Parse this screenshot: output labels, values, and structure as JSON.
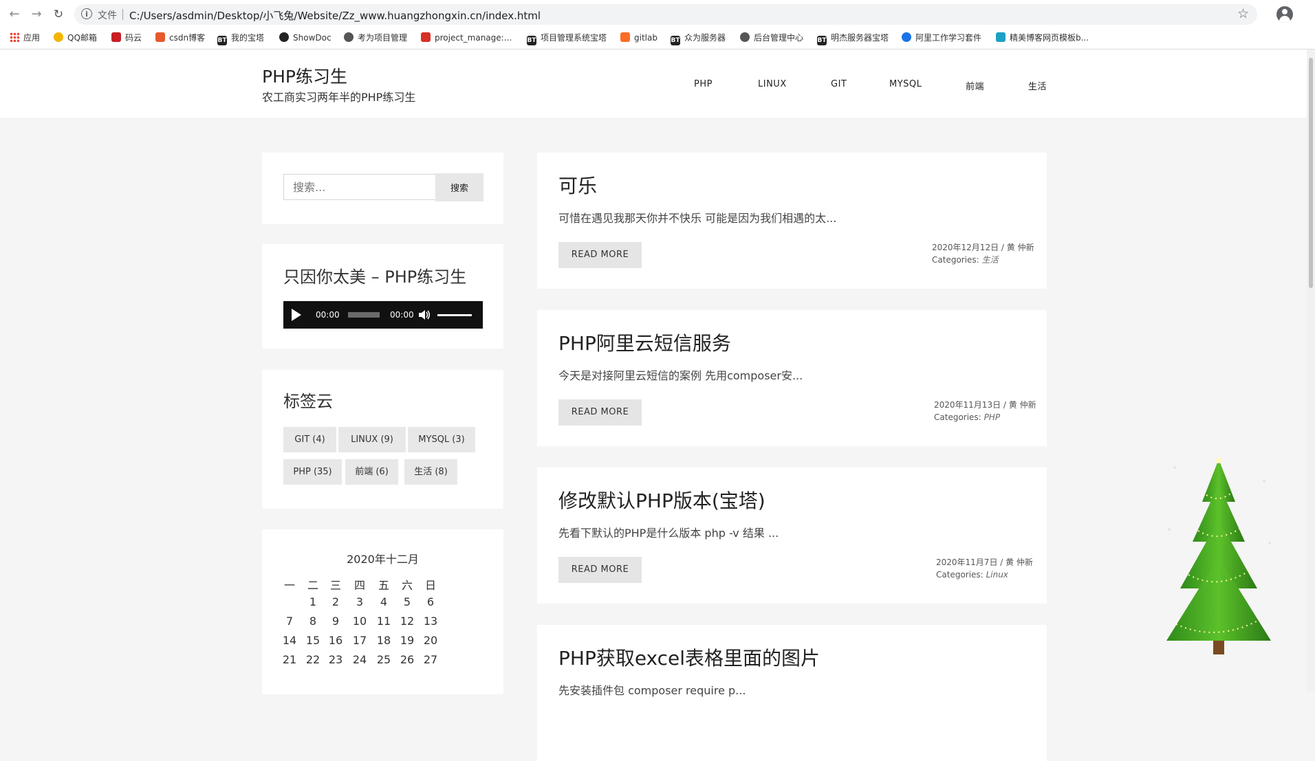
{
  "browser": {
    "file_label": "文件",
    "url": "C:/Users/asdmin/Desktop/小飞兔/Website/Zz_www.huangzhongxin.cn/index.html",
    "bookmarks": [
      {
        "label": "应用",
        "icon": "apps-grid-icon",
        "color": "#ea4335"
      },
      {
        "label": "QQ邮箱",
        "icon": "qq-mail-icon",
        "color": "#f4b400"
      },
      {
        "label": "码云",
        "icon": "gitee-icon",
        "color": "#c71d23"
      },
      {
        "label": "csdn博客",
        "icon": "csdn-icon",
        "color": "#e85a2c"
      },
      {
        "label": "我的宝塔",
        "icon": "bt-icon",
        "color": "#222222"
      },
      {
        "label": "ShowDoc",
        "icon": "showdoc-icon",
        "color": "#222222"
      },
      {
        "label": "考为项目管理",
        "icon": "globe-icon",
        "color": "#555555"
      },
      {
        "label": "project_manage:...",
        "icon": "project-icon",
        "color": "#d93025"
      },
      {
        "label": "项目管理系统宝塔",
        "icon": "bt-icon",
        "color": "#222222"
      },
      {
        "label": "gitlab",
        "icon": "gitlab-icon",
        "color": "#fc6d26"
      },
      {
        "label": "众为服务器",
        "icon": "bt-icon",
        "color": "#222222"
      },
      {
        "label": "后台管理中心",
        "icon": "globe-icon",
        "color": "#555555"
      },
      {
        "label": "明杰服务器宝塔",
        "icon": "bt-icon",
        "color": "#222222"
      },
      {
        "label": "阿里工作学习套件",
        "icon": "aliyun-icon",
        "color": "#1a73e8"
      },
      {
        "label": "精美博客网页模板b...",
        "icon": "cube-icon",
        "color": "#1ca0c4"
      }
    ]
  },
  "site": {
    "title": "PHP练习生",
    "tagline": "农工商实习两年半的PHP练习生",
    "menu": [
      "PHP",
      "LINUX",
      "GIT",
      "MYSQL",
      "前端",
      "生活"
    ]
  },
  "sidebar": {
    "search": {
      "placeholder": "搜索...",
      "button": "搜索"
    },
    "audio": {
      "title": "只因你太美 – PHP练习生",
      "current_time": "00:00",
      "duration": "00:00",
      "progress": 0,
      "volume": 1
    },
    "tags": {
      "title": "标签云",
      "items": [
        "GIT (4)",
        "LINUX (9)",
        "MYSQL (3)",
        "PHP (35)",
        "前端 (6)",
        "生活 (8)"
      ]
    },
    "calendar": {
      "caption": "2020年十二月",
      "weekdays": [
        "一",
        "二",
        "三",
        "四",
        "五",
        "六",
        "日"
      ],
      "weeks": [
        [
          "",
          "1",
          "2",
          "3",
          "4",
          "5",
          "6"
        ],
        [
          "7",
          "8",
          "9",
          "10",
          "11",
          "12",
          "13"
        ],
        [
          "14",
          "15",
          "16",
          "17",
          "18",
          "19",
          "20"
        ],
        [
          "21",
          "22",
          "23",
          "24",
          "25",
          "26",
          "27"
        ]
      ]
    }
  },
  "posts": [
    {
      "title": "可乐",
      "excerpt": "可惜在遇见我那天你并不快乐 可能是因为我们相遇的太...",
      "read_more": "READ MORE",
      "date": "2020年12月12日 / 黄 仲新",
      "categories_label": "Categories:",
      "category": "生活"
    },
    {
      "title": "PHP阿里云短信服务",
      "excerpt": "今天是对接阿里云短信的案例 先用composer安...",
      "read_more": "READ MORE",
      "date": "2020年11月13日 / 黄 仲新",
      "categories_label": "Categories:",
      "category": "PHP"
    },
    {
      "title": "修改默认PHP版本(宝塔)",
      "excerpt": "先看下默认的PHP是什么版本 php -v 结果 ...",
      "read_more": "READ MORE",
      "date": "2020年11月7日 / 黄 仲新",
      "categories_label": "Categories:",
      "category": "Linux"
    },
    {
      "title": "PHP获取excel表格里面的图片",
      "excerpt": "先安装插件包 composer require p..."
    }
  ]
}
